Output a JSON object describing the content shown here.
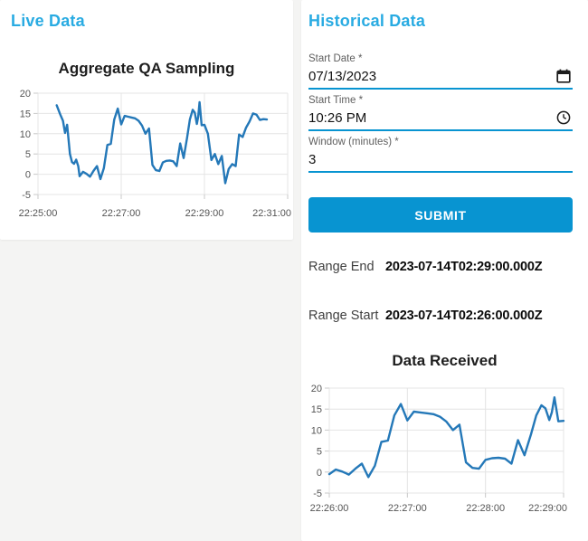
{
  "theme": {
    "background": "#f4f4f3",
    "heading_color": "#29abe2",
    "primary_color": "#0894d1",
    "chart_line_color": "#2478b8"
  },
  "live_panel": {
    "heading": "Live Data"
  },
  "historical_panel": {
    "heading": "Historical Data",
    "fields": {
      "start_date": {
        "label": "Start Date *",
        "value": "07/13/2023",
        "icon": "calendar-icon"
      },
      "start_time": {
        "label": "Start Time *",
        "value": "10:26 PM",
        "icon": "clock-icon"
      },
      "window": {
        "label": "Window (minutes) *",
        "value": "3"
      }
    },
    "submit_label": "SUBMIT",
    "results": {
      "range_end": {
        "label": "Range End",
        "value": "2023-07-14T02:29:00.000Z"
      },
      "range_start": {
        "label": "Range Start",
        "value": "2023-07-14T02:26:00.000Z"
      }
    }
  },
  "chart_data": [
    {
      "type": "line",
      "title": "Aggregate QA Sampling",
      "xlabel": "",
      "ylabel": "",
      "x_unit": "seconds after 22:25:00",
      "xlim": [
        0,
        360
      ],
      "ylim": [
        -5,
        20
      ],
      "grid": true,
      "legend": "none",
      "y_ticks": [
        20,
        15,
        10,
        5,
        0,
        -5
      ],
      "x_ticks": [
        {
          "t": 0,
          "label": "22:25:00"
        },
        {
          "t": 120,
          "label": "22:27:00"
        },
        {
          "t": 240,
          "label": "22:29:00"
        },
        {
          "t": 360,
          "label": "22:31:00"
        }
      ],
      "line_color": "#2478b8",
      "grid_color": "#e4e4e4",
      "tick_stub_color": "#c8c8c8",
      "points": [
        [
          27,
          17
        ],
        [
          32,
          14.8
        ],
        [
          36,
          13.2
        ],
        [
          39,
          10.2
        ],
        [
          42,
          12.2
        ],
        [
          46,
          5.0
        ],
        [
          49,
          3.0
        ],
        [
          52,
          2.6
        ],
        [
          55,
          3.6
        ],
        [
          58,
          2.0
        ],
        [
          60,
          -0.5
        ],
        [
          65,
          0.6
        ],
        [
          70,
          0.1
        ],
        [
          75,
          -0.6
        ],
        [
          80,
          0.8
        ],
        [
          85,
          2.0
        ],
        [
          90,
          -1.2
        ],
        [
          95,
          1.5
        ],
        [
          100,
          7.2
        ],
        [
          105,
          7.5
        ],
        [
          110,
          13.5
        ],
        [
          115,
          16.2
        ],
        [
          120,
          12.3
        ],
        [
          125,
          14.4
        ],
        [
          130,
          14.2
        ],
        [
          135,
          14.0
        ],
        [
          140,
          13.8
        ],
        [
          145,
          13.2
        ],
        [
          150,
          12.0
        ],
        [
          155,
          10.0
        ],
        [
          160,
          11.3
        ],
        [
          165,
          2.3
        ],
        [
          170,
          1.0
        ],
        [
          175,
          0.8
        ],
        [
          180,
          2.9
        ],
        [
          185,
          3.3
        ],
        [
          190,
          3.4
        ],
        [
          195,
          3.2
        ],
        [
          200,
          2.0
        ],
        [
          205,
          7.6
        ],
        [
          210,
          4.0
        ],
        [
          215,
          9.0
        ],
        [
          219,
          13.5
        ],
        [
          223,
          15.9
        ],
        [
          226,
          15.2
        ],
        [
          229,
          12.4
        ],
        [
          231,
          14.2
        ],
        [
          233,
          17.8
        ],
        [
          236,
          12.1
        ],
        [
          240,
          12.2
        ],
        [
          245,
          10.0
        ],
        [
          250,
          3.5
        ],
        [
          255,
          5.0
        ],
        [
          260,
          2.5
        ],
        [
          265,
          4.5
        ],
        [
          270,
          -2.2
        ],
        [
          275,
          1.3
        ],
        [
          280,
          2.5
        ],
        [
          285,
          2.0
        ],
        [
          290,
          9.8
        ],
        [
          295,
          9.2
        ],
        [
          300,
          11.5
        ],
        [
          305,
          13.0
        ],
        [
          310,
          15.0
        ],
        [
          315,
          14.7
        ],
        [
          320,
          13.4
        ],
        [
          325,
          13.6
        ],
        [
          330,
          13.5
        ]
      ]
    },
    {
      "type": "line",
      "title": "Data Received",
      "xlabel": "",
      "ylabel": "",
      "x_unit": "seconds after 22:26:00",
      "xlim": [
        0,
        180
      ],
      "ylim": [
        -5,
        20
      ],
      "grid": true,
      "legend": "none",
      "y_ticks": [
        20,
        15,
        10,
        5,
        0,
        -5
      ],
      "x_ticks": [
        {
          "t": 0,
          "label": "22:26:00"
        },
        {
          "t": 60,
          "label": "22:27:00"
        },
        {
          "t": 120,
          "label": "22:28:00"
        },
        {
          "t": 180,
          "label": "22:29:00"
        }
      ],
      "line_color": "#2478b8",
      "grid_color": "#e4e4e4",
      "tick_stub_color": "#c8c8c8",
      "points": [
        [
          0,
          -0.5
        ],
        [
          5,
          0.6
        ],
        [
          10,
          0.1
        ],
        [
          15,
          -0.6
        ],
        [
          20,
          0.8
        ],
        [
          25,
          2.0
        ],
        [
          30,
          -1.2
        ],
        [
          35,
          1.5
        ],
        [
          40,
          7.2
        ],
        [
          45,
          7.5
        ],
        [
          50,
          13.5
        ],
        [
          55,
          16.2
        ],
        [
          60,
          12.3
        ],
        [
          65,
          14.4
        ],
        [
          70,
          14.2
        ],
        [
          75,
          14.0
        ],
        [
          80,
          13.8
        ],
        [
          85,
          13.2
        ],
        [
          90,
          12.0
        ],
        [
          95,
          10.0
        ],
        [
          100,
          11.3
        ],
        [
          105,
          2.3
        ],
        [
          110,
          1.0
        ],
        [
          115,
          0.8
        ],
        [
          120,
          2.9
        ],
        [
          125,
          3.3
        ],
        [
          130,
          3.4
        ],
        [
          135,
          3.2
        ],
        [
          140,
          2.0
        ],
        [
          145,
          7.6
        ],
        [
          150,
          4.0
        ],
        [
          155,
          9.0
        ],
        [
          159,
          13.5
        ],
        [
          163,
          15.9
        ],
        [
          166,
          15.2
        ],
        [
          169,
          12.4
        ],
        [
          171,
          14.2
        ],
        [
          173,
          17.8
        ],
        [
          176,
          12.1
        ],
        [
          180,
          12.2
        ]
      ]
    }
  ]
}
